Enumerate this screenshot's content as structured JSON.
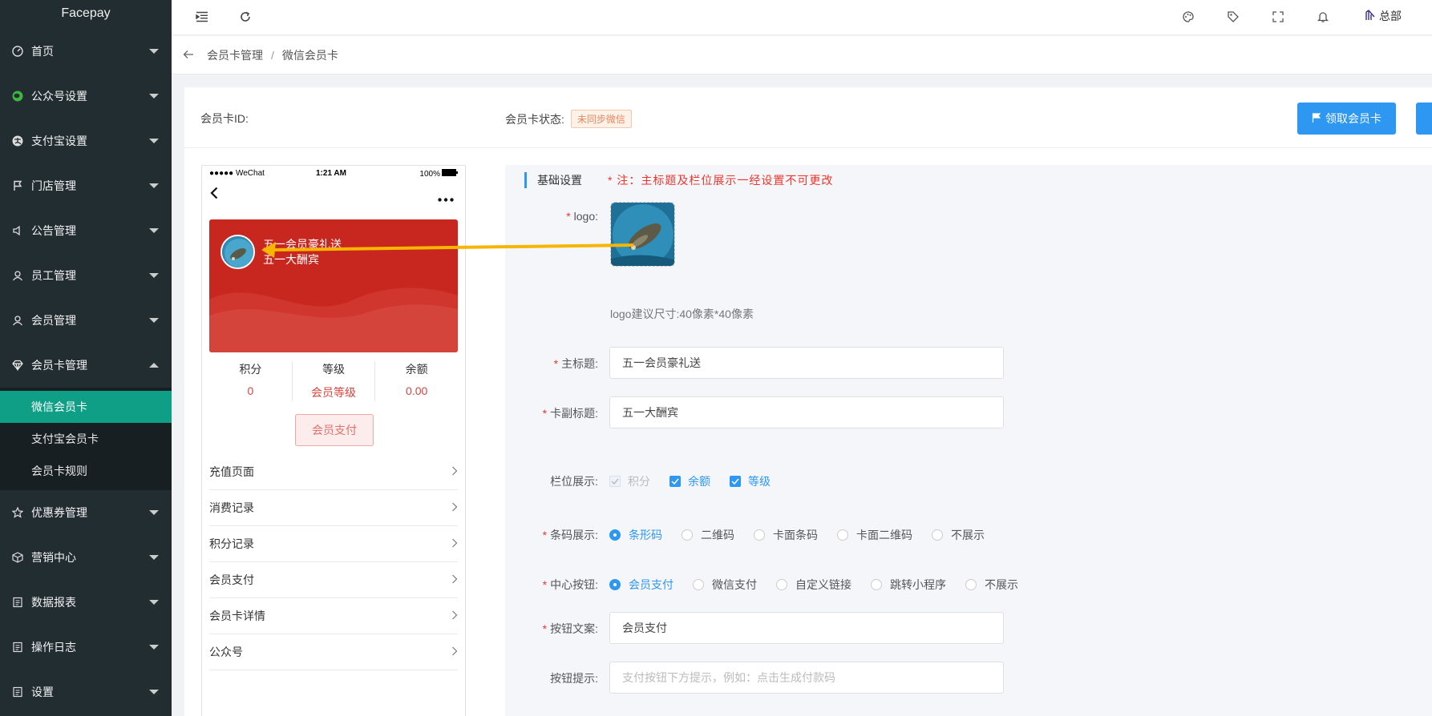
{
  "sidebar": {
    "brand": "Facepay",
    "items": [
      {
        "label": "首页",
        "icon": "dashboard-icon"
      },
      {
        "label": "公众号设置",
        "icon": "wechat-icon"
      },
      {
        "label": "支付宝设置",
        "icon": "alipay-icon"
      },
      {
        "label": "门店管理",
        "icon": "flag-icon"
      },
      {
        "label": "公告管理",
        "icon": "speaker-icon"
      },
      {
        "label": "员工管理",
        "icon": "user-icon"
      },
      {
        "label": "会员管理",
        "icon": "user-icon"
      },
      {
        "label": "会员卡管理",
        "icon": "diamond-icon"
      },
      {
        "label": "优惠券管理",
        "icon": "star-icon"
      },
      {
        "label": "营销中心",
        "icon": "box-icon"
      },
      {
        "label": "数据报表",
        "icon": "report-icon"
      },
      {
        "label": "操作日志",
        "icon": "log-icon"
      },
      {
        "label": "设置",
        "icon": "settings-icon"
      }
    ],
    "submenu": [
      "微信会员卡",
      "支付宝会员卡",
      "会员卡规则"
    ]
  },
  "header": {
    "user": "总部"
  },
  "breadcrumb": {
    "first": "会员卡管理",
    "sep": "/",
    "current": "微信会员卡"
  },
  "card_info": {
    "id_label": "会员卡ID:",
    "status_label": "会员卡状态:",
    "status_value": "未同步微信",
    "receive_button": "领取会员卡"
  },
  "phone": {
    "carrier": "●●●●● WeChat",
    "time": "1:21 AM",
    "battery": "100%",
    "card_title": "五一会员豪礼送",
    "card_subtitle": "五一大酬宾",
    "stats": [
      {
        "label": "积分",
        "value": "0"
      },
      {
        "label": "等级",
        "value": "会员等级"
      },
      {
        "label": "余额",
        "value": "0.00"
      }
    ],
    "pay_button": "会员支付",
    "list": [
      "充值页面",
      "消费记录",
      "积分记录",
      "会员支付",
      "会员卡详情",
      "公众号"
    ]
  },
  "form": {
    "section_title": "基础设置",
    "note": "* 注：主标题及栏位展示一经设置不可更改",
    "logo_label": "logo:",
    "logo_hint": "logo建议尺寸:40像素*40像素",
    "title_label": "主标题:",
    "title_value": "五一会员豪礼送",
    "subtitle_label": "卡副标题:",
    "subtitle_value": "五一大酬宾",
    "fields_label": "栏位展示:",
    "fields": [
      {
        "label": "积分",
        "state": "disabled"
      },
      {
        "label": "余额",
        "state": "checked"
      },
      {
        "label": "等级",
        "state": "checked"
      }
    ],
    "barcode_label": "条码展示:",
    "barcode_options": [
      "条形码",
      "二维码",
      "卡面条码",
      "卡面二维码",
      "不展示"
    ],
    "barcode_selected": "条形码",
    "center_label": "中心按钮:",
    "center_options": [
      "会员支付",
      "微信支付",
      "自定义链接",
      "跳转小程序",
      "不展示"
    ],
    "center_selected": "会员支付",
    "btntext_label": "按钮文案:",
    "btntext_value": "会员支付",
    "btnhint_label": "按钮提示:",
    "btnhint_placeholder": "支付按钮下方提示，例如：点击生成付款码"
  },
  "colors": {
    "accent": "#2d97f2",
    "sidebar": "#222d32",
    "active": "#0e9f86",
    "card": "#c8271f",
    "required": "#f0342c"
  }
}
